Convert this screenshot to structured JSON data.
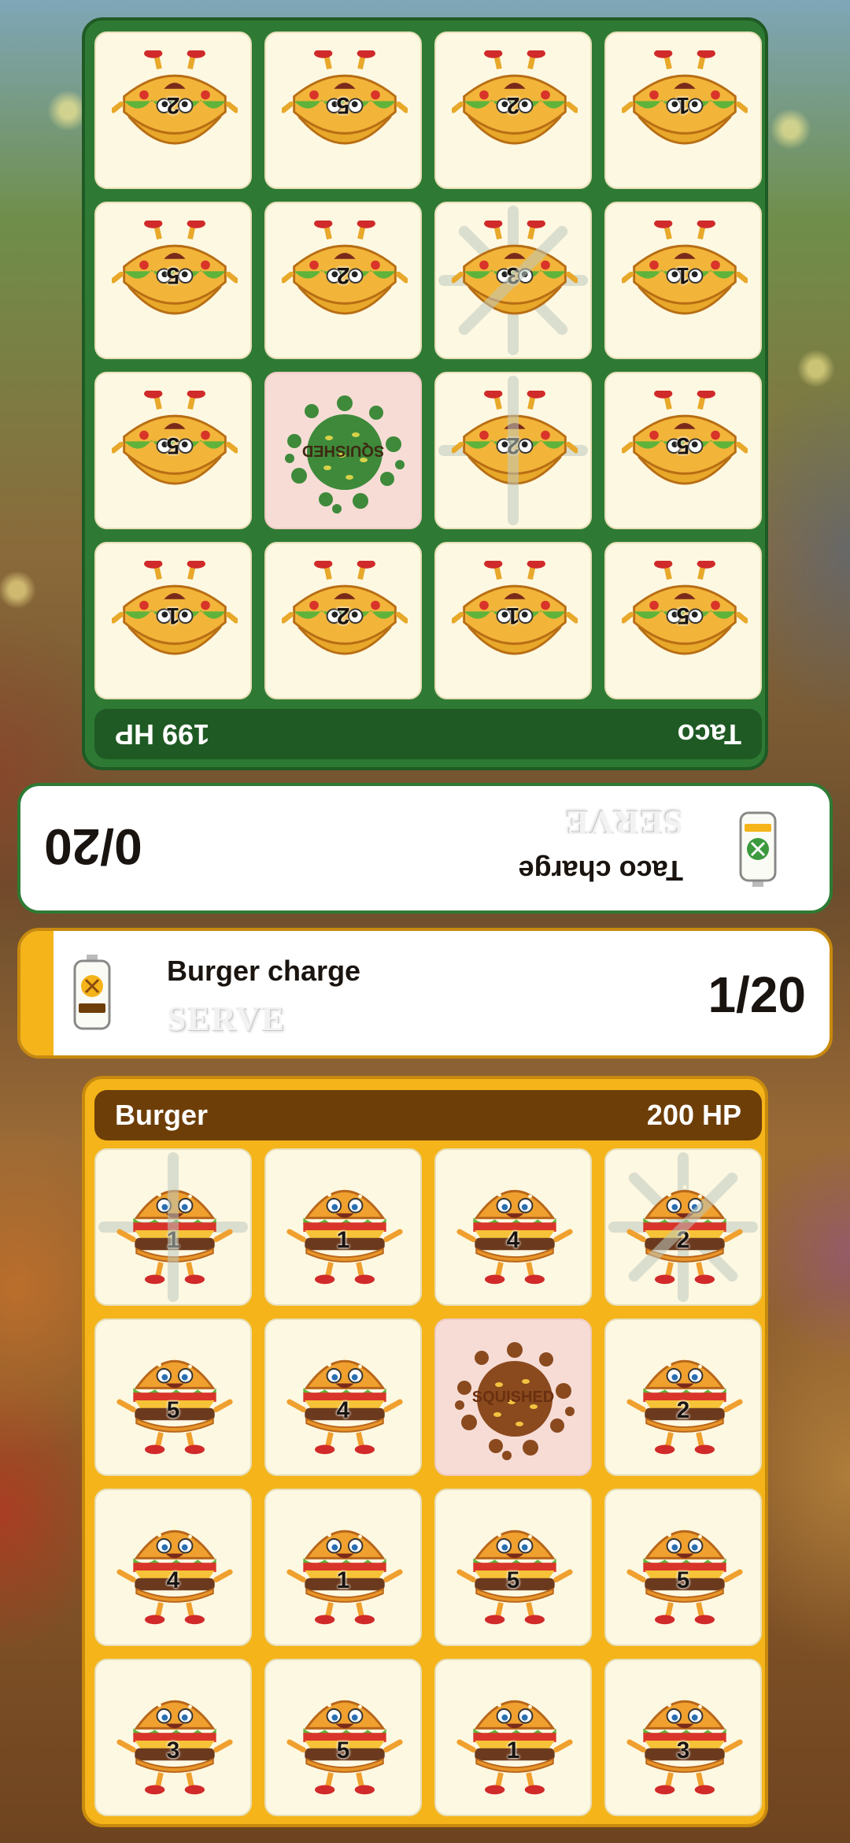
{
  "opponent": {
    "name": "Taco",
    "hp": "199 HP",
    "charge_label": "Taco charge",
    "charge_count": "0/20",
    "serve_label": "SERVE",
    "cells": [
      "2",
      "5",
      "2",
      "1",
      "5",
      "2",
      "3",
      "1",
      "5",
      "SQUISHED",
      "2",
      "5",
      "1",
      "2",
      "1",
      "5"
    ]
  },
  "player": {
    "name": "Burger",
    "hp": "200 HP",
    "charge_label": "Burger charge",
    "charge_count": "1/20",
    "serve_label": "SERVE",
    "cells": [
      "1",
      "1",
      "4",
      "2",
      "5",
      "4",
      "SQUISHED",
      "2",
      "4",
      "1",
      "5",
      "5",
      "3",
      "5",
      "1",
      "3"
    ]
  },
  "colors": {
    "taco_board": "#2e7a34",
    "burger_board": "#f4b41a",
    "squished_cell": "#f7dcd6"
  }
}
